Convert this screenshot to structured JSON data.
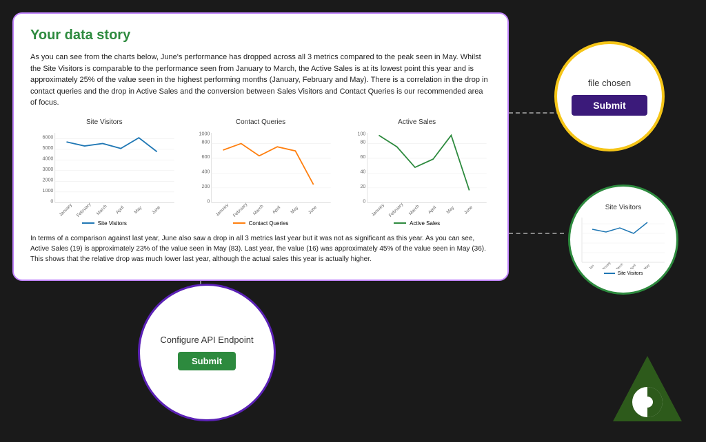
{
  "main_card": {
    "title": "Your data story",
    "description": "As you can see from the charts below, June's performance has dropped across all 3 metrics compared to the peak seen in May. Whilst the Site Visitors is comparable to the performance seen from January to March, the Active Sales is at its lowest point this year and is approximately 25% of the value seen in the highest performing months (January, February and May). There is a correlation in the drop in contact queries and the drop in Active Sales and the conversion between Sales Visitors and Contact Queries is our recommended area of focus.",
    "footer_text": "In terms of a comparison against last year, June also saw a drop in all 3 metrics last year but it was not as significant as this year. As you can see, Active Sales (19) is approximately 23% of the value seen in May (83). Last year, the value (16) was approximately 45% of the value seen in May (36). This shows that the relative drop was much lower last year, although the actual sales this year is actually higher.",
    "charts": [
      {
        "title": "Site Visitors",
        "legend": "Site Visitors",
        "color": "#1f77b4"
      },
      {
        "title": "Contact Queries",
        "legend": "Contact Queries",
        "color": "#ff7f0e"
      },
      {
        "title": "Active Sales",
        "legend": "Active Sales",
        "color": "#2d8a3e"
      }
    ]
  },
  "yellow_circle": {
    "file_text": "file chosen",
    "submit_label": "Submit"
  },
  "green_circle": {
    "title": "Site Visitors",
    "legend": "Site Visitors",
    "color": "#1f77b4"
  },
  "purple_circle": {
    "config_text": "Configure API Endpoint",
    "submit_label": "Submit"
  },
  "logo": {
    "alt": "Green triangle logo with pie chart"
  }
}
